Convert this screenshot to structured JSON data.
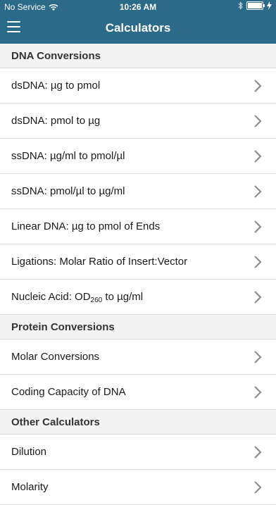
{
  "status_bar": {
    "carrier": "No Service",
    "time": "10:26 AM"
  },
  "nav": {
    "title": "Calculators"
  },
  "sections": [
    {
      "header": "DNA Conversions",
      "items": [
        "dsDNA: µg to pmol",
        "dsDNA: pmol to µg",
        "ssDNA: µg/ml to pmol/µl",
        "ssDNA: pmol/µl to µg/ml",
        "Linear DNA: µg to pmol of Ends",
        "Ligations: Molar Ratio of Insert:Vector"
      ],
      "od_item": {
        "prefix": "Nucleic Acid: OD",
        "sub": "260",
        "suffix": " to µg/ml"
      }
    },
    {
      "header": "Protein Conversions",
      "items": [
        "Molar Conversions",
        "Coding Capacity of DNA"
      ]
    },
    {
      "header": "Other Calculators",
      "items": [
        "Dilution",
        "Molarity"
      ]
    }
  ]
}
